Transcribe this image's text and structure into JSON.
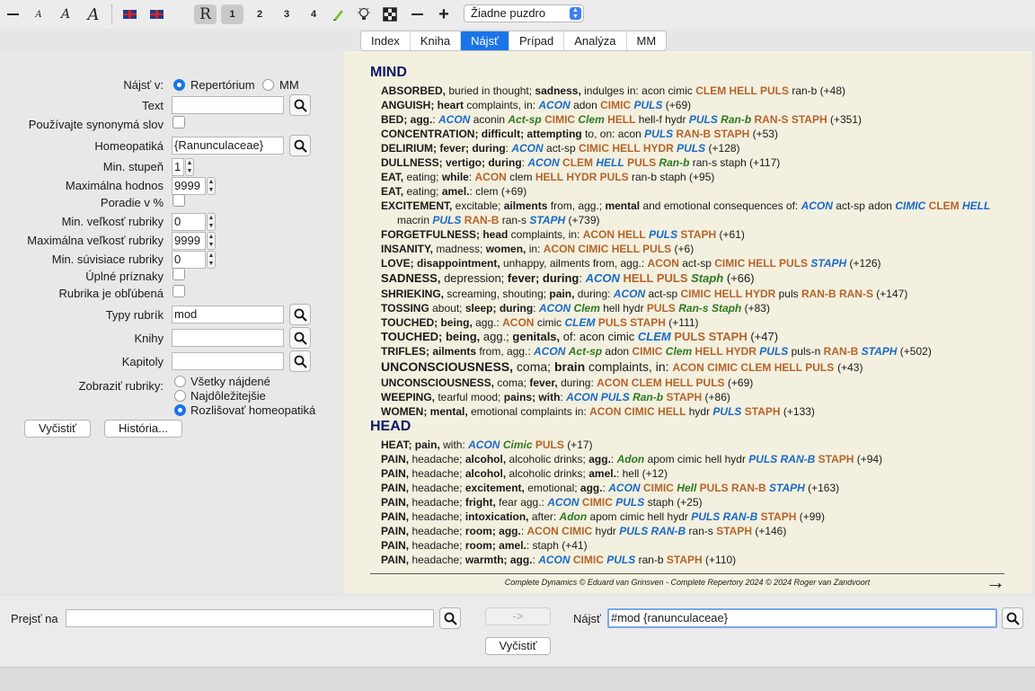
{
  "toolbar": {
    "font_sizes": [
      "A",
      "A",
      "A"
    ],
    "r_label": "R",
    "levels": [
      "1",
      "2",
      "3",
      "4"
    ],
    "remedy_select": "Žiadne puzdro"
  },
  "tabs": [
    {
      "label": "Index",
      "active": false
    },
    {
      "label": "Kniha",
      "active": false
    },
    {
      "label": "Nájsť",
      "active": true
    },
    {
      "label": "Prípad",
      "active": false
    },
    {
      "label": "Analýza",
      "active": false
    },
    {
      "label": "MM",
      "active": false
    }
  ],
  "form": {
    "find_in_label": "Nájsť v:",
    "find_in_options": [
      "Repertórium",
      "MM"
    ],
    "text_label": "Text",
    "text_value": "",
    "synonyms_label": "Používajte synonymá slov",
    "homeopathic_label": "Homeopatiká",
    "homeopathic_value": "{Ranunculaceae}",
    "min_degree_label": "Min. stupeň",
    "min_degree_value": "1",
    "max_value_label": "Maximálna hodnos",
    "max_value_value": "9999",
    "percent_label": "Poradie v %",
    "min_rubric_label": "Min. veľkosť rubriky",
    "min_rubric_value": "0",
    "max_rubric_label": "Maximálna veľkosť rubriky",
    "max_rubric_value": "9999",
    "min_related_label": "Min. súvisiace rubriky",
    "min_related_value": "0",
    "complete_label": "Úplné príznaky",
    "favorite_label": "Rubrika je obľúbená",
    "rubric_types_label": "Typy rubrík",
    "rubric_types_value": "mod",
    "books_label": "Knihy",
    "books_value": "",
    "chapters_label": "Kapitoly",
    "chapters_value": "",
    "show_label": "Zobraziť rubriky:",
    "show_options": [
      "Všetky nájdené",
      "Najdôležitejšie",
      "Rozlišovať homeopatiká"
    ],
    "clear_button": "Vyčistiť",
    "history_button": "História..."
  },
  "content": {
    "chapters": [
      {
        "title": "MIND"
      },
      {
        "title": "HEAD"
      }
    ],
    "footer": "Complete Dynamics © Eduard van Grinsven   -   Complete Repertory 2024 © 2024 Roger van Zandvoort"
  },
  "bottom": {
    "goto_label": "Prejsť na",
    "goto_value": "",
    "arrow_button": "->",
    "find_label": "Nájsť",
    "find_value": "#mod {ranunculaceae}",
    "clear_button": "Vyčistiť"
  }
}
